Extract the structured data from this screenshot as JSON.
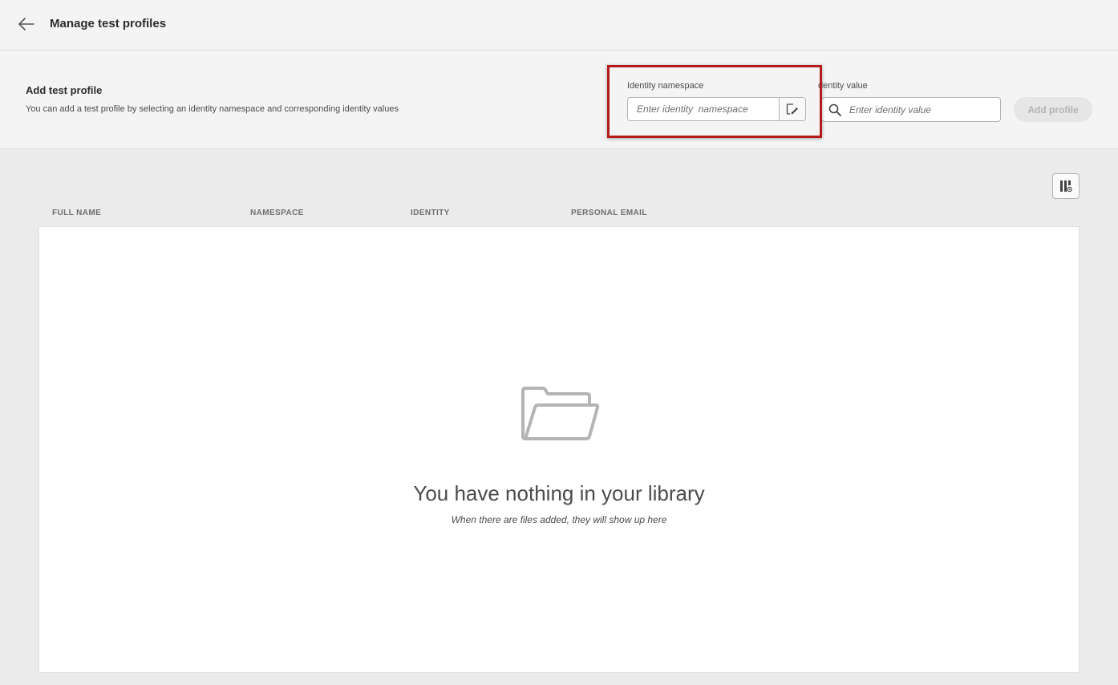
{
  "header": {
    "title": "Manage test profiles",
    "back_icon": "arrow-left-icon"
  },
  "add_profile": {
    "title": "Add test profile",
    "description": "You can add a test profile by selecting an identity namespace and corresponding identity values",
    "namespace_label": "Identity namespace",
    "namespace_placeholder": "Enter identity  namespace",
    "namespace_picker_icon": "edit-select-icon",
    "value_label": "dentity value",
    "value_placeholder": "Enter identity value",
    "value_search_icon": "search-icon",
    "add_button": "Add profile"
  },
  "table": {
    "settings_icon": "column-settings-icon",
    "columns": [
      "FULL NAME",
      "NAMESPACE",
      "IDENTITY",
      "PERSONAL EMAIL"
    ],
    "rows": []
  },
  "empty_state": {
    "icon": "folder-open-icon",
    "title": "You have nothing in your library",
    "subtitle": "When there are files added, they will show up here"
  },
  "colors": {
    "highlight_border": "#b51b1b",
    "background": "#ebebeb",
    "panel": "#f4f4f4"
  }
}
